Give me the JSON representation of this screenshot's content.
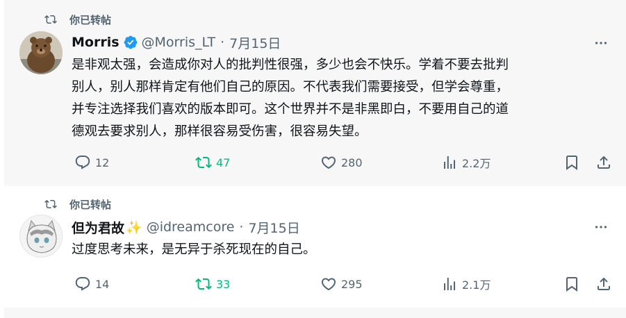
{
  "tweets": [
    {
      "retweet_label": "你已转帖",
      "display_name": "Morris",
      "handle": "@Morris_LT",
      "separator": "·",
      "date": "7月15日",
      "text_lines": [
        "是非观太强，会造成你对人的批判性很强，多少也会不快乐。学着不要去批判",
        "别人，别人那样肯定有他们自己的原因。不代表我们需要接受，但学会尊重，",
        "并专注选择我们喜欢的版本即可。这个世界并不是非黑即白，不要用自己的道",
        "德观去要求别人，那样很容易受伤害，很容易失望。"
      ],
      "replies": "12",
      "reposts": "47",
      "likes": "280",
      "views": "2.2万",
      "verified_icon": "verified-badge-icon",
      "avatar_icon": "bear-avatar"
    },
    {
      "retweet_label": "你已转帖",
      "display_name": "但为君故",
      "name_emoji": "✨",
      "handle": "@idreamcore",
      "separator": "·",
      "date": "7月15日",
      "text_lines": [
        "过度思考未来，是无异于杀死现在的自己。"
      ],
      "replies": "14",
      "reposts": "33",
      "likes": "295",
      "views": "2.1万",
      "avatar_icon": "anime-cat-avatar"
    }
  ],
  "colors": {
    "text": "#0f1419",
    "muted": "#536471",
    "repost_active": "#00ba7c",
    "verified": "#1d9bf0",
    "retweeted_bg": "#f7f7f7"
  }
}
